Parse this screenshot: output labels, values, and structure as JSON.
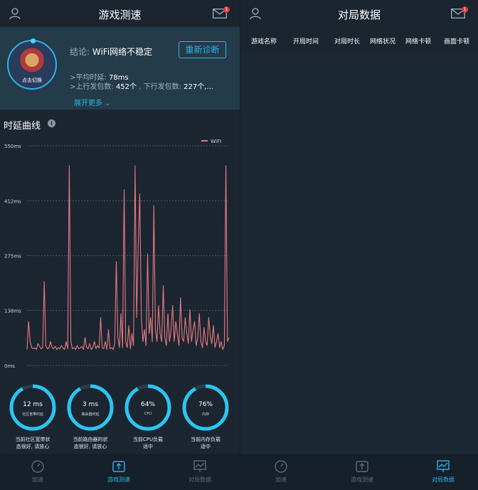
{
  "left": {
    "title": "游戏测速",
    "mail_badge": "1",
    "avatar_label": "点击切换",
    "conclusion_key": "结论:",
    "conclusion_value": "WiFi网络不稳定",
    "rediagnose_label": "重新诊断",
    "avg_delay_label": ">平均时延:",
    "avg_delay_value": "78ms",
    "packets_label": ">上行发包数:",
    "up_packets": "452个",
    "down_label": ", 下行发包数:",
    "down_packets": "227个,...",
    "expand_label": "展开更多",
    "section_title": "时延曲线",
    "gauges": [
      {
        "value": "12 ms",
        "sub": "社区宽带时延",
        "desc1": "当前社区宽带状",
        "desc2": "态很好, 请放心"
      },
      {
        "value": "3 ms",
        "sub": "路由器时延",
        "desc1": "当前路由器的状",
        "desc2": "态很好, 请放心"
      },
      {
        "value": "64%",
        "sub": "CPU",
        "desc1": "当前CPU负载",
        "desc2": "适中"
      },
      {
        "value": "76%",
        "sub": "内存",
        "desc1": "当前内存负载",
        "desc2": "适中"
      }
    ],
    "gauge_levels": [
      0.92,
      0.92,
      0.92,
      0.92
    ],
    "nav": [
      "加速",
      "游戏测速",
      "对局数据"
    ]
  },
  "right": {
    "title": "对局数据",
    "mail_badge": "1",
    "columns": [
      "游戏名称",
      "开局时间",
      "对局时长",
      "网络状况",
      "网络卡顿",
      "画面卡顿"
    ],
    "nav": [
      "加速",
      "游戏测速",
      "对局数据"
    ]
  },
  "colors": {
    "accent": "#2bb6e8",
    "line": "#e57a80",
    "background": "#1b2631"
  },
  "chart_data": {
    "type": "line",
    "title": "时延曲线",
    "ylim": [
      0,
      550
    ],
    "yticks": [
      0,
      138,
      275,
      412,
      550
    ],
    "ytick_labels": [
      "0ms",
      "138ms",
      "275ms",
      "412ms",
      "550ms"
    ],
    "grid": true,
    "legend": "top-right",
    "series": [
      {
        "name": "WIFI",
        "values": [
          40,
          110,
          60,
          45,
          42,
          44,
          40,
          55,
          48,
          42,
          45,
          210,
          50,
          42,
          44,
          60,
          45,
          42,
          48,
          40,
          45,
          42,
          50,
          44,
          40,
          60,
          42,
          500,
          60,
          42,
          45,
          40,
          50,
          42,
          44,
          48,
          40,
          70,
          45,
          42,
          55,
          40,
          45,
          60,
          42,
          50,
          44,
          120,
          45,
          42,
          60,
          40,
          90,
          42,
          45,
          40,
          55,
          260,
          70,
          45,
          130,
          45,
          440,
          60,
          45,
          100,
          42,
          80,
          50,
          500,
          120,
          300,
          430,
          120,
          60,
          90,
          50,
          280,
          80,
          120,
          60,
          400,
          90,
          60,
          150,
          80,
          60,
          200,
          70,
          50,
          130,
          60,
          90,
          150,
          60,
          110,
          80,
          50,
          170,
          70,
          60,
          120,
          80,
          55,
          140,
          60,
          90,
          110,
          50,
          70,
          130,
          60,
          45,
          95,
          60,
          50,
          120,
          75,
          55,
          100,
          45,
          60,
          80,
          45,
          60,
          40,
          50,
          500,
          60,
          70
        ]
      }
    ]
  }
}
